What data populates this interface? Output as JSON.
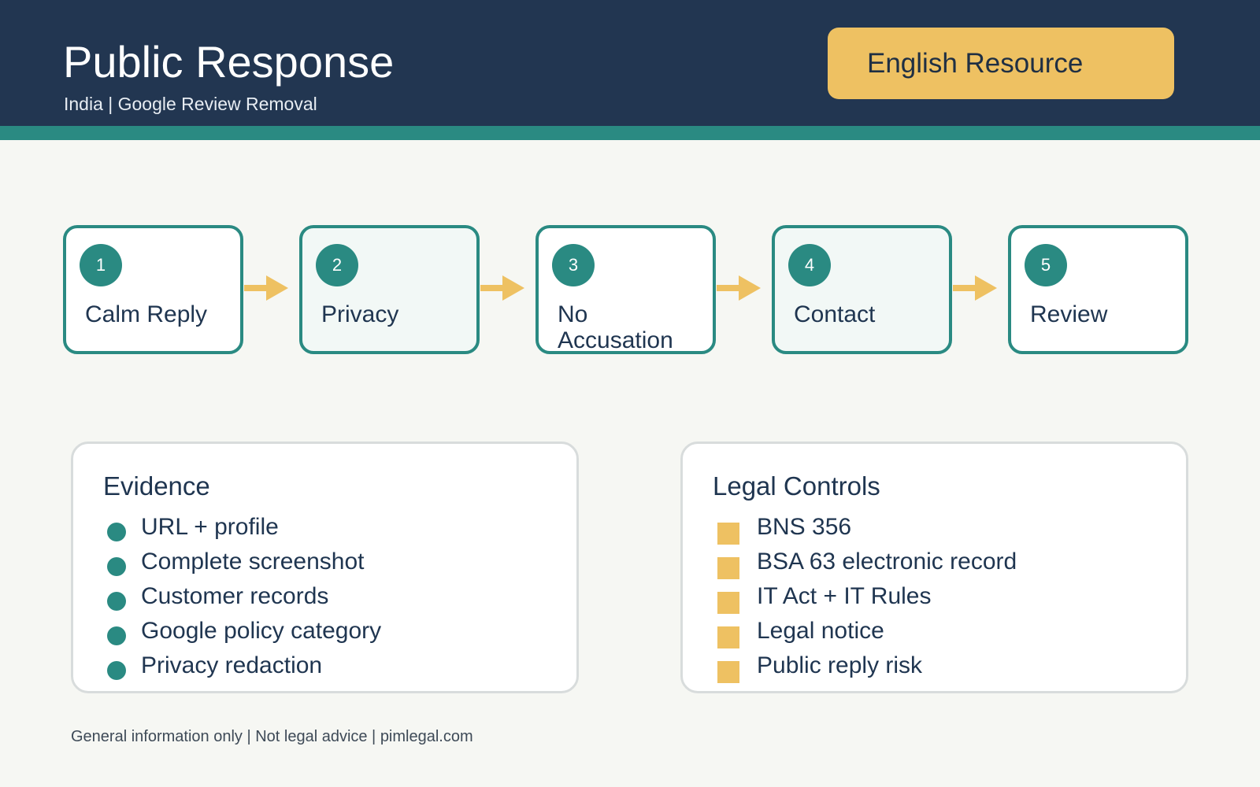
{
  "header": {
    "title": "Public Response",
    "subtitle": "India | Google Review Removal",
    "badge": "English Resource"
  },
  "steps": [
    {
      "number": "1",
      "label": "Calm Reply"
    },
    {
      "number": "2",
      "label": "Privacy"
    },
    {
      "number": "3",
      "label": "No Accusation"
    },
    {
      "number": "4",
      "label": "Contact"
    },
    {
      "number": "5",
      "label": "Review"
    }
  ],
  "evidence": {
    "title": "Evidence",
    "items": [
      "URL + profile",
      "Complete screenshot",
      "Customer records",
      "Google policy category",
      "Privacy redaction"
    ]
  },
  "legal_controls": {
    "title": "Legal Controls",
    "items": [
      "BNS 356",
      "BSA 63 electronic record",
      "IT Act + IT Rules",
      "Legal notice",
      "Public reply risk"
    ]
  },
  "footer": "General information only | Not legal advice | pimlegal.com",
  "colors": {
    "navy": "#223651",
    "teal": "#2a8a82",
    "gold": "#eec162",
    "background": "#f6f7f3"
  }
}
